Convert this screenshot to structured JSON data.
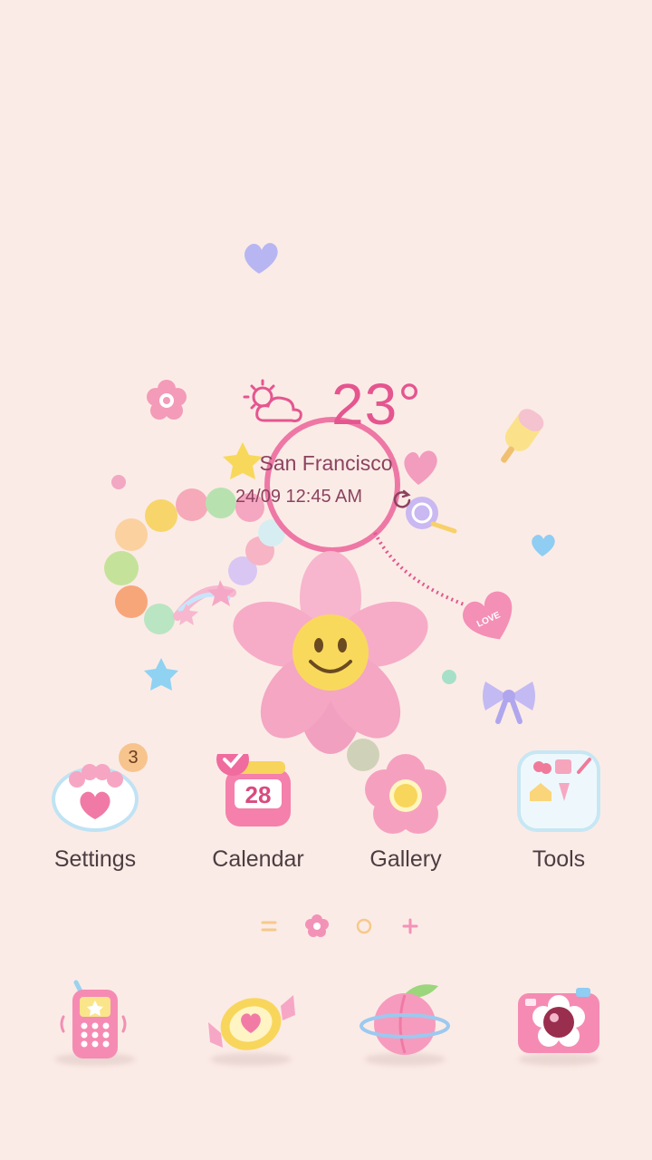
{
  "weather": {
    "temperature": "23°",
    "city": "San Francisco",
    "datetime": "24/09 12:45 AM",
    "icon": "partly-cloudy-icon"
  },
  "apps": [
    {
      "label": "Settings",
      "icon": "paw-settings-icon",
      "badge": "3"
    },
    {
      "label": "Calendar",
      "icon": "calendar-jar-icon",
      "day": "28"
    },
    {
      "label": "Gallery",
      "icon": "flower-gallery-icon"
    },
    {
      "label": "Tools",
      "icon": "tools-folder-icon"
    }
  ],
  "page_indicator": {
    "items": [
      "menu-page-icon",
      "flower-page-icon",
      "circle-page-icon",
      "add-page-icon"
    ],
    "active": 1
  },
  "dock": [
    {
      "icon": "phone-icon"
    },
    {
      "icon": "candy-messages-icon"
    },
    {
      "icon": "peach-planet-browser-icon"
    },
    {
      "icon": "camera-icon"
    }
  ],
  "colors": {
    "background": "#fbebe6",
    "accent_pink": "#e5558f",
    "text_dark": "#4c3d42",
    "text_widget": "#8c4260"
  }
}
